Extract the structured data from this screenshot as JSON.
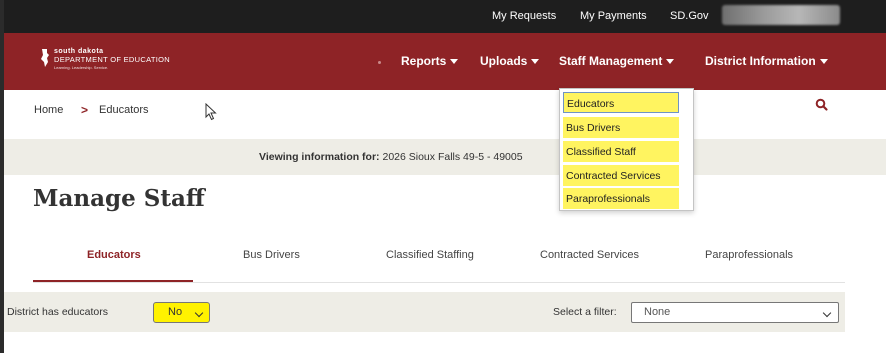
{
  "top_bar": {
    "links": [
      "My Requests",
      "My Payments",
      "SD.Gov"
    ]
  },
  "header": {
    "logo": {
      "line1": "south dakota",
      "line2": "DEPARTMENT OF EDUCATION",
      "line3": "Learning. Leadership. Service."
    },
    "nav": [
      {
        "label": "Reports"
      },
      {
        "label": "Uploads"
      },
      {
        "label": "Staff Management"
      },
      {
        "label": "District Information"
      }
    ]
  },
  "breadcrumb": {
    "home": "Home",
    "separator": ">",
    "current": "Educators"
  },
  "staff_menu": {
    "items": [
      "Educators",
      "Bus Drivers",
      "Classified Staff",
      "Contracted Services",
      "Paraprofessionals"
    ]
  },
  "viewing": {
    "label": "Viewing information for:",
    "value": "2026 Sioux Falls 49-5 - 49005"
  },
  "page_title": "Manage Staff",
  "tabs": [
    {
      "label": "Educators",
      "active": true
    },
    {
      "label": "Bus Drivers",
      "active": false
    },
    {
      "label": "Classified Staffing",
      "active": false
    },
    {
      "label": "Contracted Services",
      "active": false
    },
    {
      "label": "Paraprofessionals",
      "active": false
    }
  ],
  "filters": {
    "has_educators_label": "District has educators",
    "has_educators_value": "No",
    "filter_label": "Select a filter:",
    "filter_value": "None"
  },
  "icons": {
    "search": "search-icon",
    "caret": "caret-down-icon",
    "cursor": "mouse-cursor-icon",
    "logo": "state-outline-icon"
  },
  "colors": {
    "brand": "#8e2326",
    "top_bar": "#1e1e1e",
    "highlight": "#fff460",
    "panel": "#eeede6"
  }
}
